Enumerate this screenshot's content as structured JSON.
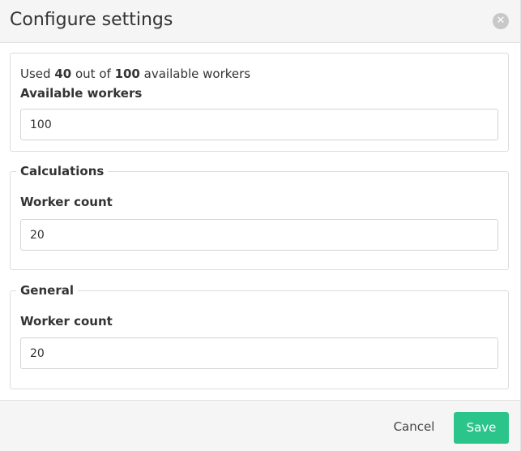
{
  "dialog": {
    "title": "Configure settings",
    "close_icon": "close-icon"
  },
  "usage": {
    "prefix": "Used",
    "used": "40",
    "middle": "out of",
    "total": "100",
    "suffix": "available workers"
  },
  "available_workers": {
    "label": "Available workers",
    "value": "100"
  },
  "calculations": {
    "legend": "Calculations",
    "label": "Worker count",
    "value": "20"
  },
  "general": {
    "legend": "General",
    "label": "Worker count",
    "value": "20"
  },
  "footer": {
    "cancel_label": "Cancel",
    "save_label": "Save"
  },
  "colors": {
    "header_bg": "#f5f5f5",
    "save_button": "#2bc48a",
    "border": "#dcdcdc"
  }
}
